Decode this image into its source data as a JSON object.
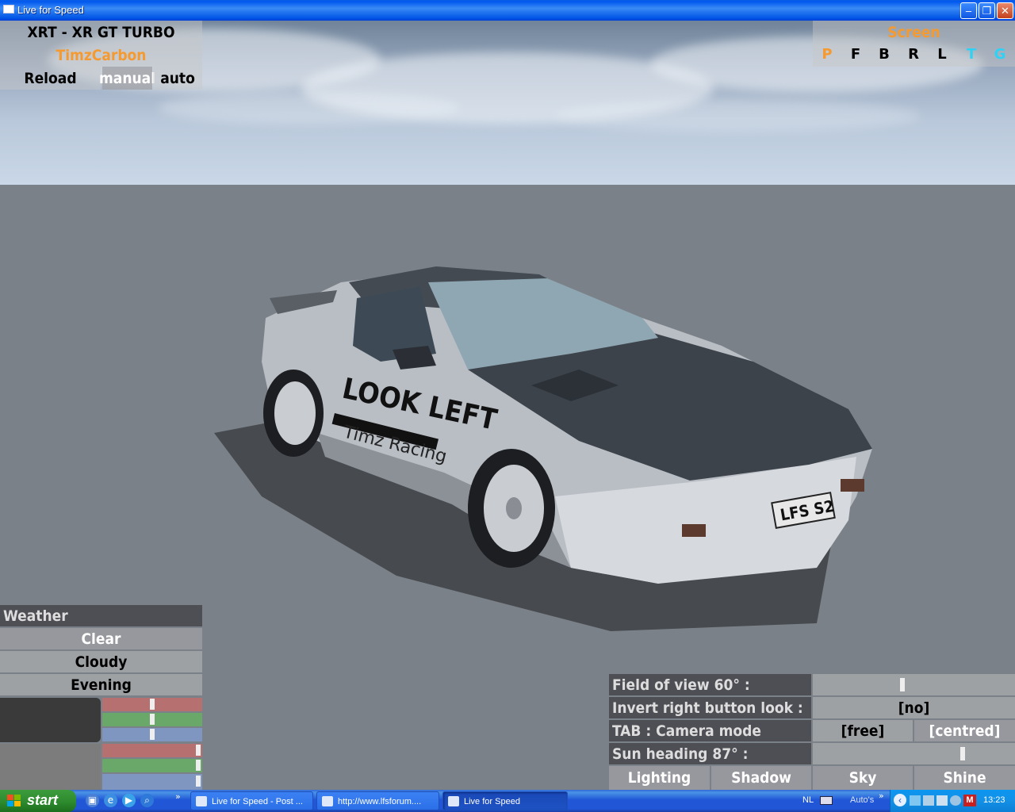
{
  "window": {
    "title": "Live for Speed"
  },
  "car_panel": {
    "car_name": "XRT - XR GT TURBO",
    "skin_name": "TimzCarbon",
    "reload_label": "Reload",
    "manual_label": "manual",
    "auto_label": "auto"
  },
  "screen_panel": {
    "title": "Screen",
    "views": [
      "P",
      "F",
      "B",
      "R",
      "L",
      "T",
      "G"
    ]
  },
  "weather": {
    "header": "Weather",
    "options": [
      "Clear",
      "Cloudy",
      "Evening"
    ]
  },
  "camera_settings": {
    "fov_label": "Field of view 60° :",
    "fov_value": 60,
    "invert_label": "Invert right button look :",
    "invert_value": "[no]",
    "tab_label": "TAB : Camera mode",
    "mode_free": "[free]",
    "mode_centred": "[centred]",
    "sun_label": "Sun heading 87° :",
    "sun_value": 87,
    "buttons": [
      "Lighting",
      "Shadow",
      "Sky",
      "Shine"
    ]
  },
  "car_render": {
    "door_decal": "LOOK LEFT",
    "door_sub_decal": "Timz Racing",
    "plate": "LFS S2"
  },
  "taskbar": {
    "start_label": "start",
    "tasks": [
      "Live for Speed - Post ...",
      "http://www.lfsforum....",
      "Live for Speed"
    ],
    "language": "NL",
    "toolbar_label": "Auto's",
    "time": "13:23"
  },
  "colors": {
    "orange_text": "#f59a30",
    "cyan_text": "#2ed2f5",
    "taskbar_blue": "#2157d7",
    "start_green": "#2d8a2d"
  }
}
